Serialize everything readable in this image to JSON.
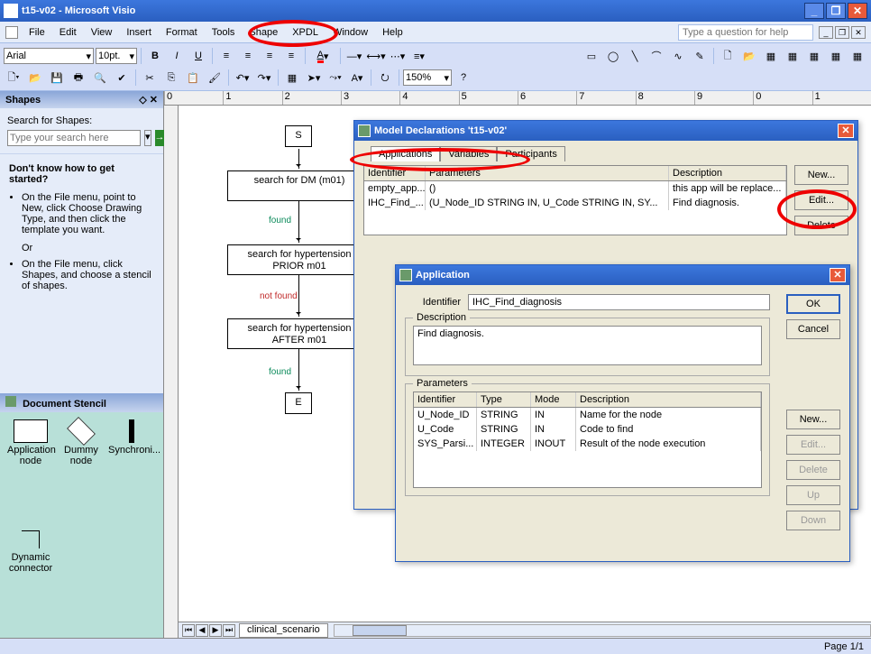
{
  "window": {
    "title": "t15-v02 - Microsoft Visio"
  },
  "menu": {
    "items": [
      "File",
      "Edit",
      "View",
      "Insert",
      "Format",
      "Tools",
      "Shape",
      "XPDL",
      "Window",
      "Help"
    ],
    "helpPlaceholder": "Type a question for help"
  },
  "toolbar": {
    "font": "Arial",
    "fontSize": "10pt.",
    "zoom": "150%"
  },
  "shapes": {
    "title": "Shapes",
    "searchLabel": "Search for Shapes:",
    "searchPlaceholder": "Type your search here",
    "tipsTitle": "Don't know how to get started?",
    "tip1": "On the File menu, point to New, click Choose Drawing Type, and then click the template you want.",
    "or": "Or",
    "tip2": "On the File menu, click Shapes, and choose a stencil of shapes.",
    "stencilTitle": "Document Stencil",
    "stencilItems": [
      "Application node",
      "Dummy node",
      "Synchroni...",
      "Dynamic connector"
    ]
  },
  "flowchart": {
    "start": "S",
    "box1": "search for  DM (m01)",
    "box2": "search for hypertension PRIOR m01",
    "box3": "search for hypertension AFTER  m01",
    "end": "E",
    "notFound": "not found",
    "found": "found"
  },
  "canvasTab": "clinical_scenario",
  "status": {
    "page": "Page 1/1"
  },
  "modelDlg": {
    "title": "Model Declarations 't15-v02'",
    "tabs": [
      "Applications",
      "Variables",
      "Participants"
    ],
    "cols": [
      "Identifier",
      "Parameters",
      "Description"
    ],
    "rows": [
      {
        "id": "empty_app...",
        "params": "()",
        "desc": "this app will be replace..."
      },
      {
        "id": "IHC_Find_...",
        "params": "(U_Node_ID STRING IN, U_Code STRING IN, SY...",
        "desc": "Find diagnosis."
      }
    ],
    "btnNew": "New...",
    "btnEdit": "Edit...",
    "btnDelete": "Delete"
  },
  "appDlg": {
    "title": "Application",
    "identifierLabel": "Identifier",
    "identifierValue": "IHC_Find_diagnosis",
    "descLabel": "Description",
    "descValue": "Find diagnosis.",
    "paramsLabel": "Parameters",
    "paramCols": [
      "Identifier",
      "Type",
      "Mode",
      "Description"
    ],
    "paramRows": [
      {
        "id": "U_Node_ID",
        "type": "STRING",
        "mode": "IN",
        "desc": "Name for the node"
      },
      {
        "id": "U_Code",
        "type": "STRING",
        "mode": "IN",
        "desc": "Code to find"
      },
      {
        "id": "SYS_Parsi...",
        "type": "INTEGER",
        "mode": "INOUT",
        "desc": "Result of the node execution"
      }
    ],
    "btnOK": "OK",
    "btnCancel": "Cancel",
    "btnNew": "New...",
    "btnEdit": "Edit...",
    "btnDelete": "Delete",
    "btnUp": "Up",
    "btnDown": "Down"
  }
}
